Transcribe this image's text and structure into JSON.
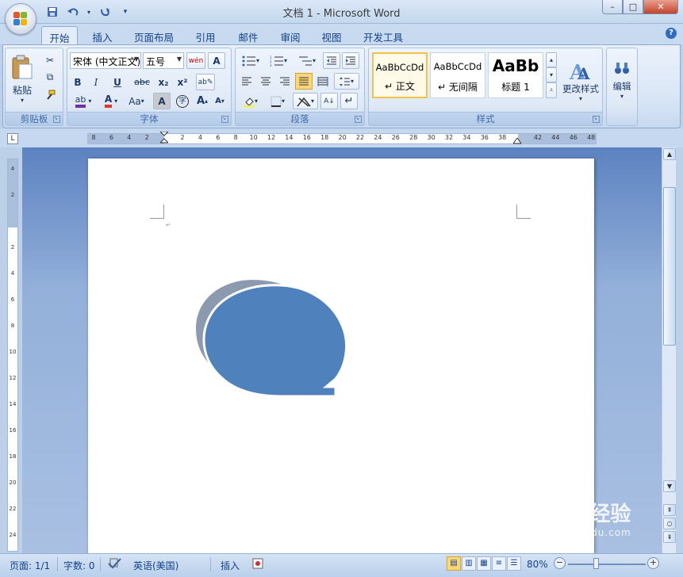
{
  "window": {
    "title": "文档 1 - Microsoft Word",
    "controls": {
      "minimize": "–",
      "maximize": "□",
      "close": "✕"
    }
  },
  "quick_access": {
    "save_icon": "save-icon",
    "undo_icon": "undo-icon",
    "redo_icon": "redo-icon",
    "customize_icon": "customize-icon"
  },
  "tabs": [
    {
      "label": "开始",
      "active": true
    },
    {
      "label": "插入"
    },
    {
      "label": "页面布局"
    },
    {
      "label": "引用"
    },
    {
      "label": "邮件"
    },
    {
      "label": "审阅"
    },
    {
      "label": "视图"
    },
    {
      "label": "开发工具"
    }
  ],
  "ribbon": {
    "clipboard": {
      "label": "剪贴板",
      "paste": "粘贴"
    },
    "font": {
      "label": "字体",
      "font_name": "宋体 (中文正文)",
      "font_size": "五号",
      "wen": "wén",
      "bold": "B",
      "italic": "I",
      "underline": "U",
      "strike": "abc",
      "subscript": "x₂",
      "superscript": "x²",
      "highlight": "ab",
      "font_color": "A",
      "change_case": "Aa",
      "char_shading": "A",
      "enclose": "字",
      "grow": "A",
      "shrink": "A"
    },
    "paragraph": {
      "label": "段落"
    },
    "styles": {
      "label": "样式",
      "tiles": [
        {
          "sample": "AaBbCcDd",
          "name": "↵ 正文",
          "selected": true
        },
        {
          "sample": "AaBbCcDd",
          "name": "↵ 无间隔"
        },
        {
          "sample": "AaBb",
          "name": "标题 1"
        }
      ],
      "change_styles": "更改样式"
    },
    "editing": {
      "label": "编辑"
    }
  },
  "ruler": {
    "marks": [
      "8",
      "6",
      "4",
      "2",
      "",
      "2",
      "4",
      "6",
      "8",
      "10",
      "12",
      "14",
      "16",
      "18",
      "20",
      "22",
      "24",
      "26",
      "28",
      "30",
      "32",
      "34",
      "36",
      "38",
      "",
      "42",
      "44",
      "46",
      "48"
    ],
    "v_marks": [
      "4",
      "2",
      "",
      "2",
      "4",
      "6",
      "8",
      "10",
      "12",
      "14",
      "16",
      "18",
      "20",
      "22",
      "24"
    ]
  },
  "document": {
    "shape": {
      "fill": "#4f81bd",
      "shadow": "#8b9aaf",
      "outline": "#ffffff"
    }
  },
  "status": {
    "page": "页面: 1/1",
    "words": "字数: 0",
    "language": "英语(美国)",
    "insert_mode": "插入",
    "zoom": "80%"
  },
  "watermark": {
    "main": "Baidu经验",
    "sub": "jingyan.baidu.com"
  },
  "colors": {
    "accent": "#15428b",
    "ribbon_bg": "#dbe7f6",
    "doc_bg": "#93b0da"
  }
}
